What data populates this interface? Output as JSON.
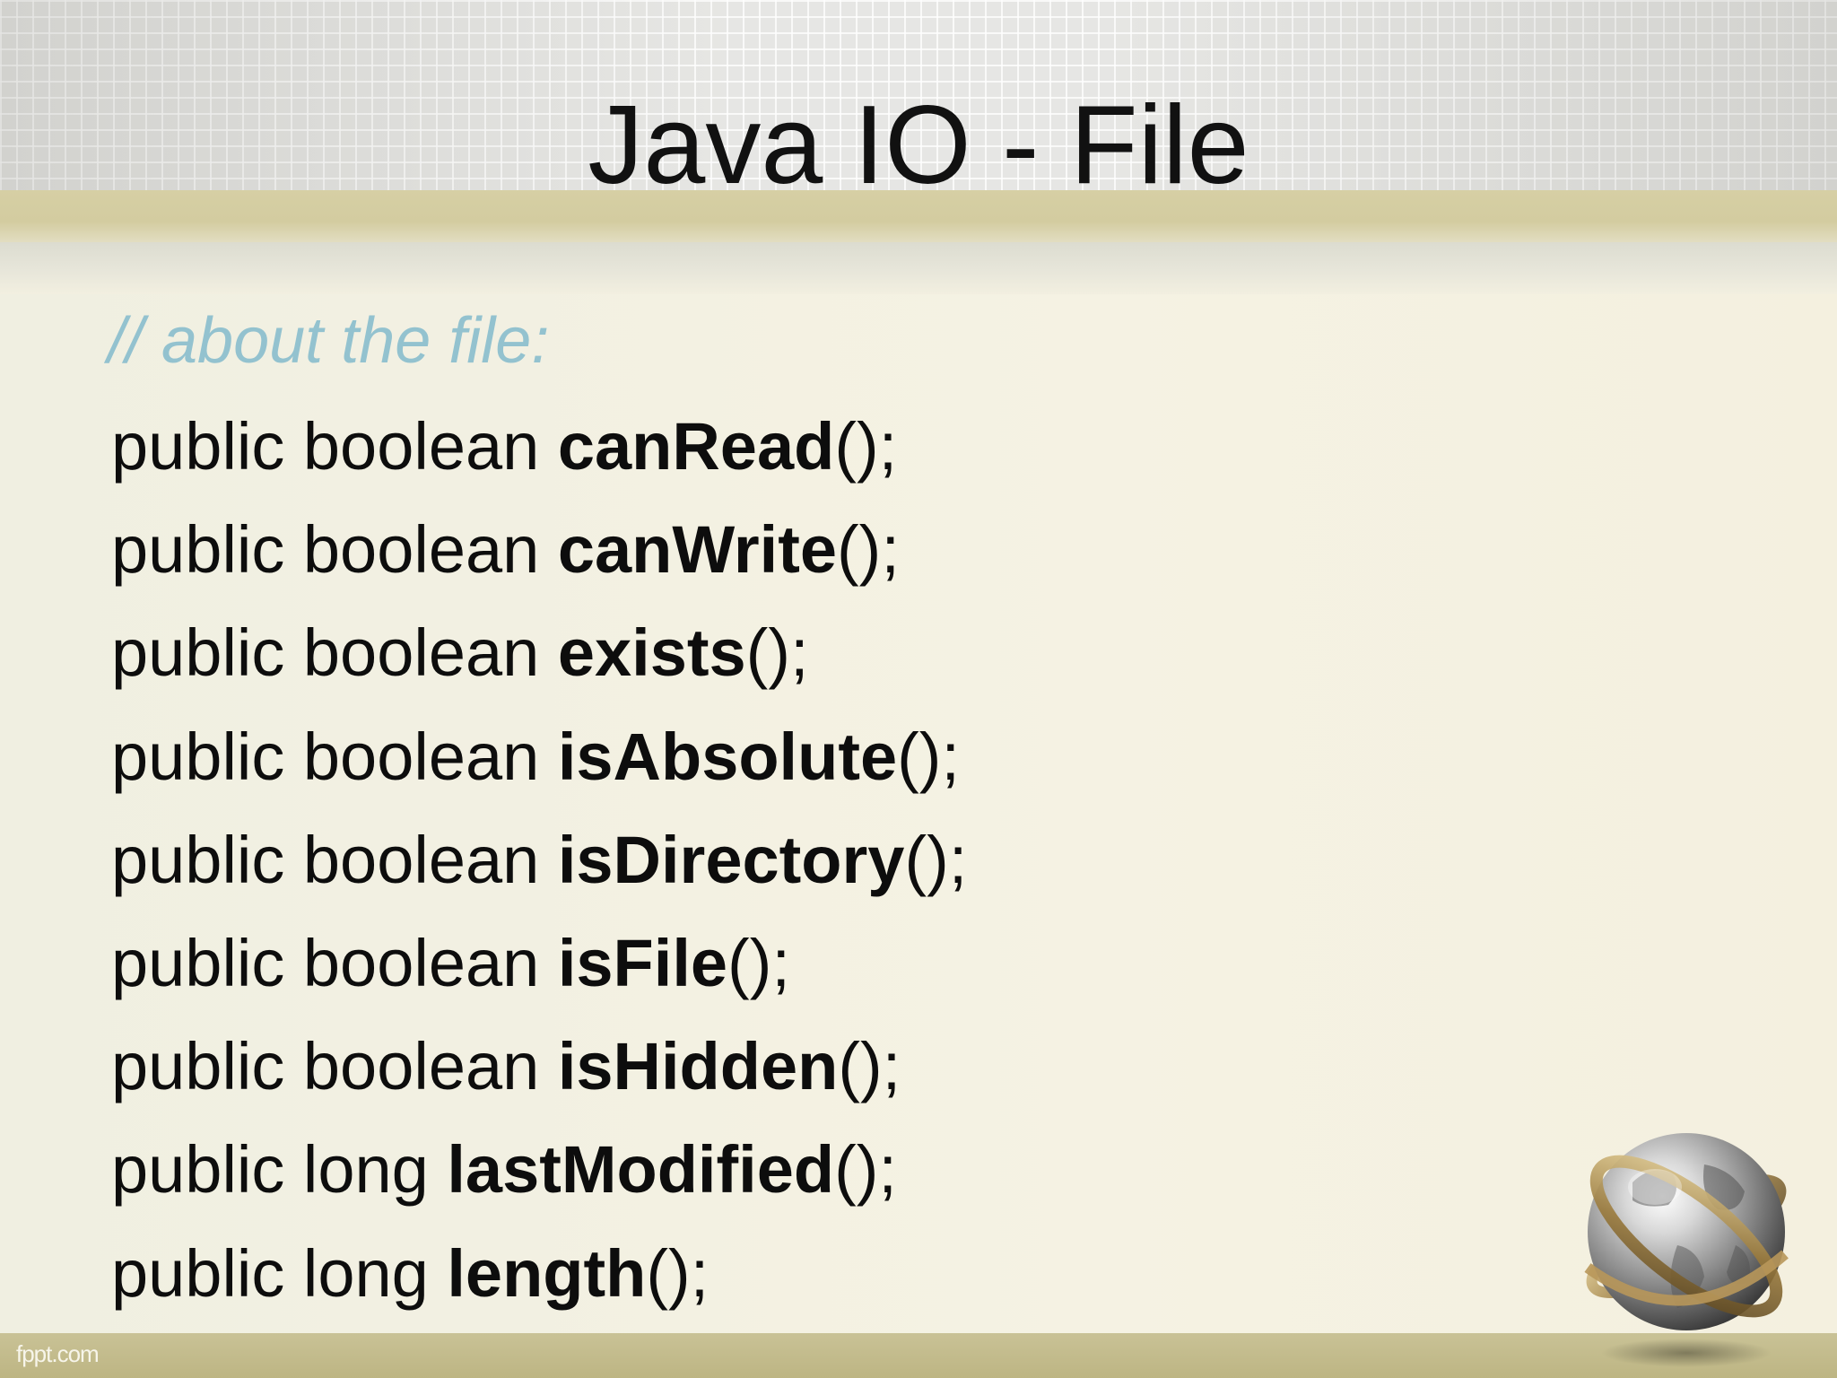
{
  "slide": {
    "title": "Java IO - File",
    "comment": "// about the file:",
    "methods": [
      {
        "prefix": "public boolean ",
        "name": "canRead",
        "suffix": "();"
      },
      {
        "prefix": "public boolean ",
        "name": "canWrite",
        "suffix": "();"
      },
      {
        "prefix": "public boolean ",
        "name": "exists",
        "suffix": "();"
      },
      {
        "prefix": "public boolean ",
        "name": "isAbsolute",
        "suffix": "();"
      },
      {
        "prefix": "public boolean ",
        "name": "isDirectory",
        "suffix": "();"
      },
      {
        "prefix": "public boolean ",
        "name": "isFile",
        "suffix": "();"
      },
      {
        "prefix": "public boolean ",
        "name": "isHidden",
        "suffix": "();"
      },
      {
        "prefix": "public long ",
        "name": "lastModified",
        "suffix": "();"
      },
      {
        "prefix": "public long ",
        "name": "length",
        "suffix": "();"
      }
    ],
    "footer": "fppt.com",
    "decoration_icon": "globe-icon"
  },
  "colors": {
    "comment": "#93c2cf",
    "text": "#0d0d0d",
    "tan_band": "#d6cfa4",
    "footer_bar": "#c4bd8c",
    "background": "#f4f1e3"
  }
}
